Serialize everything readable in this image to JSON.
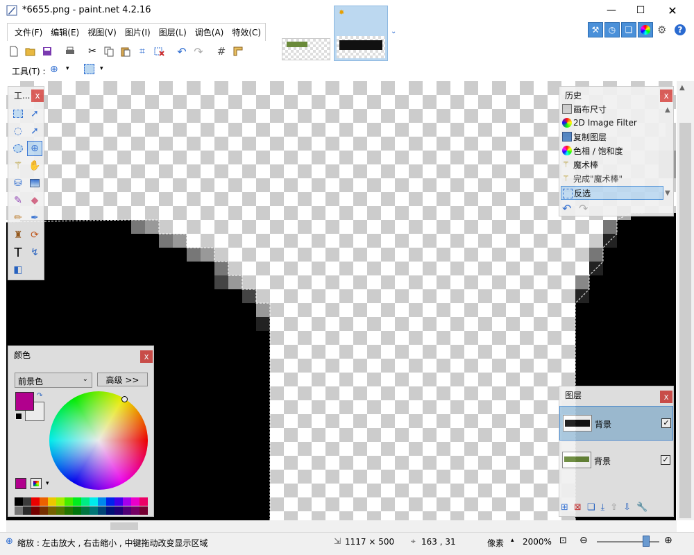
{
  "window": {
    "title": "*6655.png - paint.net 4.2.16",
    "minimize": "—",
    "maximize": "☐",
    "close": "✕"
  },
  "menu": [
    "文件(F)",
    "编辑(E)",
    "视图(V)",
    "图片(I)",
    "图层(L)",
    "调色(A)",
    "特效(C)"
  ],
  "toolbar2": {
    "tool_label": "工具(T) :"
  },
  "tools_panel": {
    "title": "工...",
    "close": "x",
    "text_tool": "T"
  },
  "history_panel": {
    "title": "历史",
    "close": "x",
    "items": [
      "画布尺寸",
      "2D Image Filter",
      "复制图层",
      "色相 / 饱和度",
      "魔术棒",
      "完成\"魔术棒\"",
      "反选"
    ],
    "selected_index": 6,
    "undo": "↶",
    "redo": "↷"
  },
  "colors_panel": {
    "title": "颜色",
    "close": "x",
    "mode": "前景色",
    "advanced": "高级 >>",
    "primary_color": "#c0009a",
    "secondary_color": "#ffffff",
    "palette_row1": [
      "#000000",
      "#404040",
      "#ff0000",
      "#ff6a00",
      "#ffd800",
      "#b6ff00",
      "#4cff00",
      "#00ff21",
      "#00ff90",
      "#00ffff",
      "#0094ff",
      "#0026ff",
      "#4800ff",
      "#b200ff",
      "#ff00dc",
      "#ff006e"
    ],
    "palette_row2": [
      "#808080",
      "#303030",
      "#7f0000",
      "#7f3300",
      "#7f6a00",
      "#5b7f00",
      "#267f00",
      "#007f0e",
      "#007f46",
      "#007f7f",
      "#004a7f",
      "#00137f",
      "#21007f",
      "#57007f",
      "#7f006e",
      "#7f0037"
    ]
  },
  "layers_panel": {
    "title": "图层",
    "close": "x",
    "layers": [
      {
        "name": "背景",
        "visible": true,
        "selected": true
      },
      {
        "name": "背景",
        "visible": true,
        "selected": false
      }
    ]
  },
  "status": {
    "hint": "缩放 : 左击放大 , 右击缩小 , 中键拖动改变显示区域",
    "image_size": "1117 × 500",
    "cursor_pos": "163 , 31",
    "unit": "像素",
    "zoom": "2000%"
  }
}
